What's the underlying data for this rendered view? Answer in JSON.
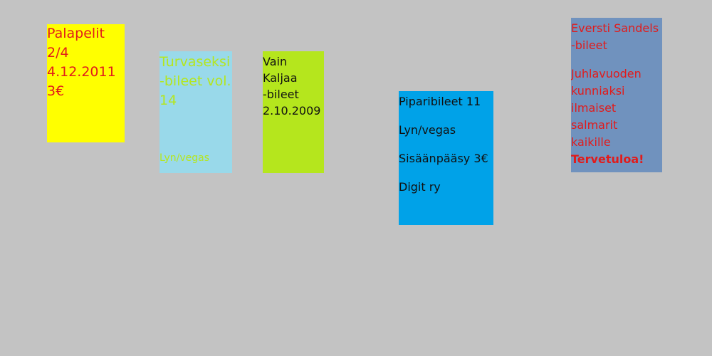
{
  "notes": [
    {
      "id": "note-1",
      "bg": "#ffff00",
      "color": "#e11b1b",
      "lines": [
        "Palapelit",
        "2/4",
        "4.12.2011",
        "3€"
      ]
    },
    {
      "id": "note-2",
      "bg": "#99d9ea",
      "color": "#b5e61d",
      "lines": [
        "Turvaseksi",
        "-bileet vol.",
        "14"
      ],
      "footer": "Lyn/vegas"
    },
    {
      "id": "note-3",
      "bg": "#b5e61d",
      "color": "#111111",
      "lines": [
        "Vain",
        "Kaljaa",
        "-bileet",
        "2.10.2009"
      ]
    },
    {
      "id": "note-4",
      "bg": "#00a2e8",
      "color": "#111111",
      "lines": [
        "Piparibileet 11",
        "Lyn/vegas",
        "Sisäänpääsy 3€",
        "Digit ry"
      ]
    },
    {
      "id": "note-5",
      "bg": "#7092be",
      "color": "#e11b1b",
      "lines": [
        "Eversti Sandels",
        "-bileet",
        "Juhlavuoden",
        "kunniaksi",
        "ilmaiset",
        "salmarit",
        "kaikille"
      ],
      "bold_line": "Tervetuloa!"
    }
  ]
}
